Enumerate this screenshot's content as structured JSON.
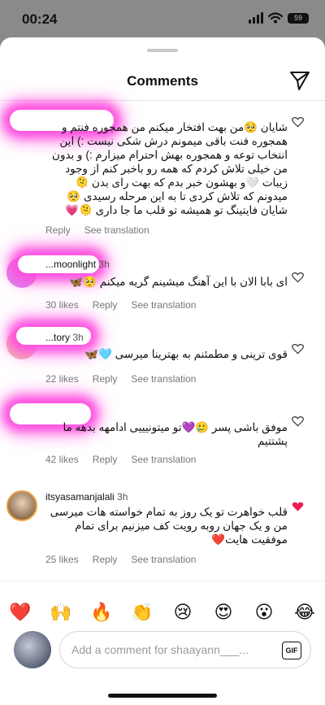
{
  "status": {
    "time": "00:24",
    "battery": "59"
  },
  "sheet": {
    "title": "Comments"
  },
  "comments": [
    {
      "username": "",
      "time": "",
      "text": "شایان 🥺من بهت افتخار میکنم من همجوره فنتم و همجوره فنت باقی میمونم درش شکی نیست :) این انتخاب توعه و همجوره بهش احترام میزارم :) و بدون من خیلی تلاش کردم که همه رو باخبر کنم از وجود زیبات 🤍و بهشون خبر بدم که بهت رای بدن 🫠 میدونم که تلاش کردی تا به این مرحله رسیدی 🥺 شایان فایتینگ تو همیشه تو قلب ما جا داری 🫠💗",
      "likes": "",
      "reply": "Reply",
      "translate": "See translation"
    },
    {
      "username": "...moonlight",
      "time": "3h",
      "text": "ای بابا الان با این آهنگ میشینم گریه میکنم 🥺🦋",
      "likes": "30 likes",
      "reply": "Reply",
      "translate": "See translation"
    },
    {
      "username": "...tory",
      "time": "3h",
      "text": "قوی ترینی و مطمئنم به بهترینا میرسی 🩵🦋",
      "likes": "22 likes",
      "reply": "Reply",
      "translate": "See translation"
    },
    {
      "username": "",
      "time": "",
      "text": "موفق باشی پسر 🥲💜تو میتونیییی ادامهه بدهه ما پشتتیم",
      "likes": "42 likes",
      "reply": "Reply",
      "translate": "See translation"
    },
    {
      "username": "itsyasamanjalali",
      "time": "3h",
      "text": "قلب خواهرت تو یک روز به تمام خواسته هات میرسی من و یک جهان روبه رویت کف میزنیم برای تمام موفقیت هایت❤️",
      "likes": "25 likes",
      "reply": "Reply",
      "translate": "See translation"
    }
  ],
  "emojis": [
    "❤️",
    "🙌",
    "🔥",
    "👏",
    "😢",
    "😍",
    "😮",
    "😂"
  ],
  "input": {
    "placeholder": "Add a comment for shaayann___...",
    "gif": "GIF"
  },
  "colors": {
    "liked_heart": "#ee1d52",
    "glow": "#ff4fe0"
  }
}
